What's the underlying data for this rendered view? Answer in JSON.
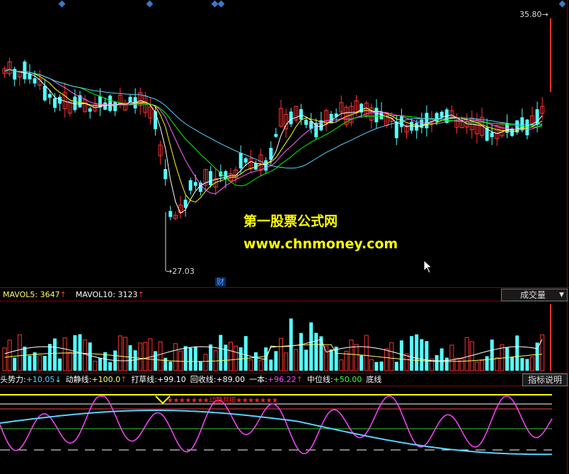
{
  "price_panel": {
    "high_label": "35.80",
    "low_label": "27.03",
    "event_badge": "财"
  },
  "watermark": {
    "line1": "第一股票公式网",
    "line2": "www.chnmoney.com"
  },
  "volume_panel": {
    "mavol5_label": "MAVOL5:",
    "mavol5_value": "3647",
    "mavol10_label": "MAVOL10:",
    "mavol10_value": "3123",
    "up_arrow": "↑",
    "dropdown_label": "成交量",
    "dropdown_arrow": "▼"
  },
  "indicator_panel": {
    "items": [
      {
        "label": "头势力:",
        "value": "+10.05",
        "arrow": "↓",
        "color": "#5ad2ff"
      },
      {
        "label": "动静线:",
        "value": "+100.0",
        "arrow": "↑",
        "color": "#ffff66"
      },
      {
        "label": "打草线:",
        "value": "+99.10",
        "arrow": "",
        "color": "#ffffff"
      },
      {
        "label": "回收线:",
        "value": "+89.00",
        "arrow": "",
        "color": "#ffffff"
      },
      {
        "label": "一本:",
        "value": "+96.22",
        "arrow": "↑",
        "color": "#ff44ff"
      },
      {
        "label": "中位线:",
        "value": "+50.00",
        "arrow": "",
        "color": "#44ff44"
      },
      {
        "label": "底线",
        "value": "",
        "arrow": "",
        "color": "#ffffff"
      }
    ],
    "help_button": "指标说明",
    "star_text": "★★★★★★★动静共振★★★★★★★"
  },
  "colors": {
    "up": "#ff3333",
    "down": "#54ffff",
    "grid": "#8b0000",
    "ma5": "#ffffff",
    "ma10": "#ffff00",
    "ma20": "#ff66ff",
    "ma30": "#00ff00",
    "ma60": "#5ad2ff"
  }
}
